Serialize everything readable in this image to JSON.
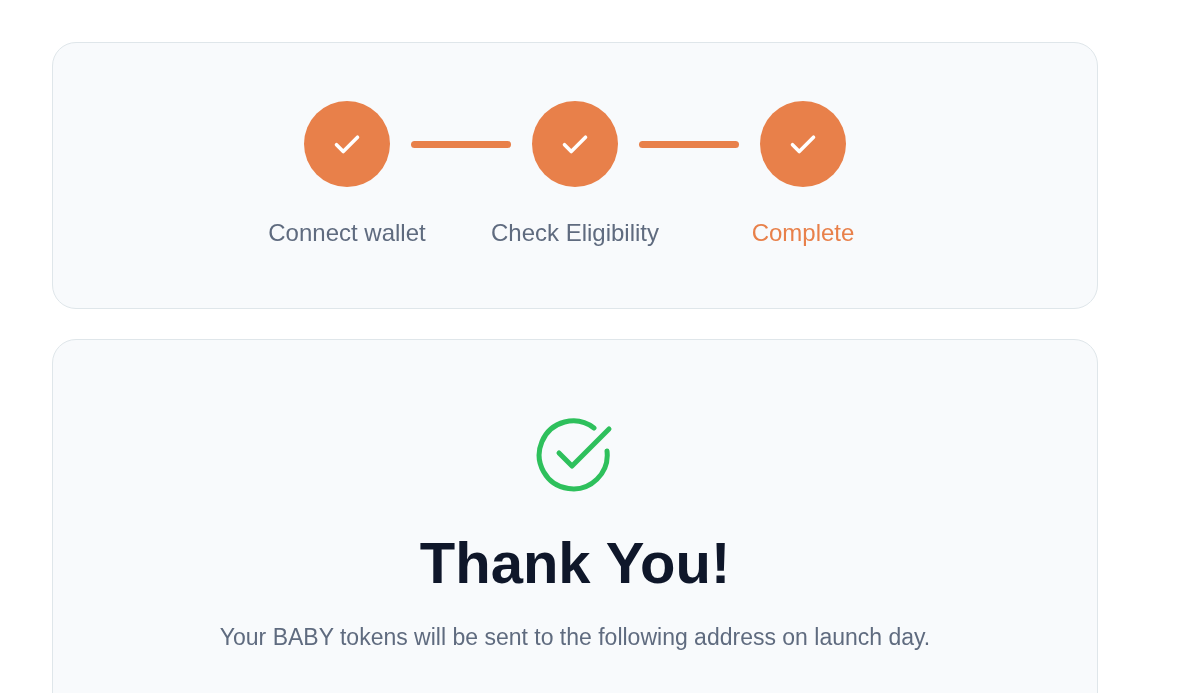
{
  "steps": [
    {
      "label": "Connect wallet",
      "completed": true,
      "selected": false
    },
    {
      "label": "Check Eligibility",
      "completed": true,
      "selected": false
    },
    {
      "label": "Complete",
      "completed": true,
      "selected": true
    }
  ],
  "result": {
    "title": "Thank You!",
    "message": "Your BABY tokens will be sent to the following address on launch day."
  }
}
